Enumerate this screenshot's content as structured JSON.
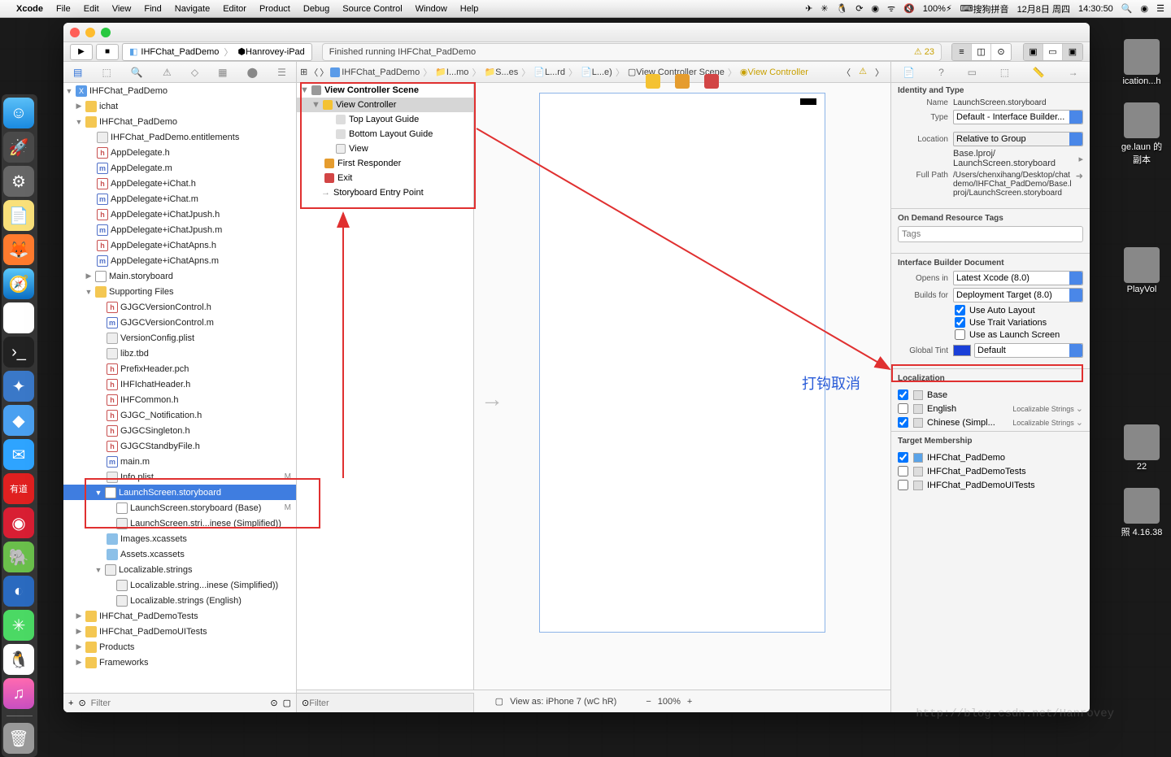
{
  "menubar": {
    "app": "Xcode",
    "items": [
      "File",
      "Edit",
      "View",
      "Find",
      "Navigate",
      "Editor",
      "Product",
      "Debug",
      "Source Control",
      "Window",
      "Help"
    ],
    "right": {
      "battery": "100%",
      "ime": "搜狗拼音",
      "date": "12月8日 周四",
      "time": "14:30:50"
    }
  },
  "toolbar": {
    "scheme_app": "IHFChat_PadDemo",
    "scheme_dev": "Hanrovey-iPad",
    "status": "Finished running IHFChat_PadDemo",
    "warn_count": "23"
  },
  "jumpbar": {
    "items": [
      "IHFChat_PadDemo",
      "I...mo",
      "S...es",
      "L...rd",
      "L...e)",
      "View Controller Scene",
      "View Controller"
    ]
  },
  "outline": {
    "scene": "View Controller Scene",
    "vc": "View Controller",
    "top": "Top Layout Guide",
    "bottom": "Bottom Layout Guide",
    "view": "View",
    "first": "First Responder",
    "exit": "Exit",
    "entry": "Storyboard Entry Point"
  },
  "canvas": {
    "bottom": "View as: iPhone 7 (wC hR)",
    "zoom": "100%"
  },
  "navigator": {
    "root": "IHFChat_PadDemo",
    "groups": {
      "ichat": "ichat",
      "demo": "IHFChat_PadDemo",
      "supporting": "Supporting Files",
      "tests": "IHFChat_PadDemoTests",
      "uitests": "IHFChat_PadDemoUITests",
      "products": "Products",
      "frameworks": "Frameworks"
    },
    "files": {
      "entitle": "IHFChat_PadDemo.entitlements",
      "appdelh": "AppDelegate.h",
      "appdelm": "AppDelegate.m",
      "adich": "AppDelegate+iChat.h",
      "adicm": "AppDelegate+iChat.m",
      "adjph": "AppDelegate+iChatJpush.h",
      "adjpm": "AppDelegate+iChatJpush.m",
      "adaph": "AppDelegate+iChatApns.h",
      "adapm": "AppDelegate+iChatApns.m",
      "mainsb": "Main.storyboard",
      "gjvh": "GJGCVersionControl.h",
      "gjvm": "GJGCVersionControl.m",
      "verplist": "VersionConfig.plist",
      "libz": "libz.tbd",
      "prefix": "PrefixHeader.pch",
      "ihfheader": "IHFIchatHeader.h",
      "ihfcommon": "IHFCommon.h",
      "gjnotif": "GJGC_Notification.h",
      "gjsingle": "GJGCSingleton.h",
      "gjstandby": "GJGCStandbyFile.h",
      "mainm": "main.m",
      "infoplist": "Info.plist",
      "launchsb": "LaunchScreen.storyboard",
      "launchbase": "LaunchScreen.storyboard (Base)",
      "launchzh": "LaunchScreen.stri...inese (Simplified))",
      "images": "Images.xcassets",
      "assets": "Assets.xcassets",
      "locstr": "Localizable.strings",
      "locstrzh": "Localizable.string...inese (Simplified))",
      "locstren": "Localizable.strings (English)"
    },
    "mod": "M",
    "filter_ph": "Filter"
  },
  "inspector": {
    "identity_h": "Identity and Type",
    "name_l": "Name",
    "name_v": "LaunchScreen.storyboard",
    "type_l": "Type",
    "type_v": "Default - Interface Builder...",
    "loc_l": "Location",
    "loc_v": "Relative to Group",
    "loc_path1": "Base.lproj/",
    "loc_path2": "LaunchScreen.storyboard",
    "full_l": "Full Path",
    "full_v": "/Users/chenxihang/Desktop/chatdemo/IHFChat_PadDemo/Base.lproj/LaunchScreen.storyboard",
    "ondemand_h": "On Demand Resource Tags",
    "tags_ph": "Tags",
    "ibdoc_h": "Interface Builder Document",
    "opens_l": "Opens in",
    "opens_v": "Latest Xcode (8.0)",
    "builds_l": "Builds for",
    "builds_v": "Deployment Target (8.0)",
    "autolayout": "Use Auto Layout",
    "trait": "Use Trait Variations",
    "launch": "Use as Launch Screen",
    "tint_l": "Global Tint",
    "tint_v": "Default",
    "local_h": "Localization",
    "base": "Base",
    "english": "English",
    "chinese": "Chinese (Simpl...",
    "locstrings": "Localizable Strings",
    "target_h": "Target Membership",
    "t1": "IHFChat_PadDemo",
    "t2": "IHFChat_PadDemoTests",
    "t3": "IHFChat_PadDemoUITests"
  },
  "annotation": "打钩取消",
  "watermark": "http://blog.csdn.net/Hanrovey",
  "desktop": {
    "i1": "ication...h",
    "i2": "ge.laun 的副本",
    "i3": "PlayVol",
    "i4": "22",
    "i5": "照 4.16.38"
  }
}
